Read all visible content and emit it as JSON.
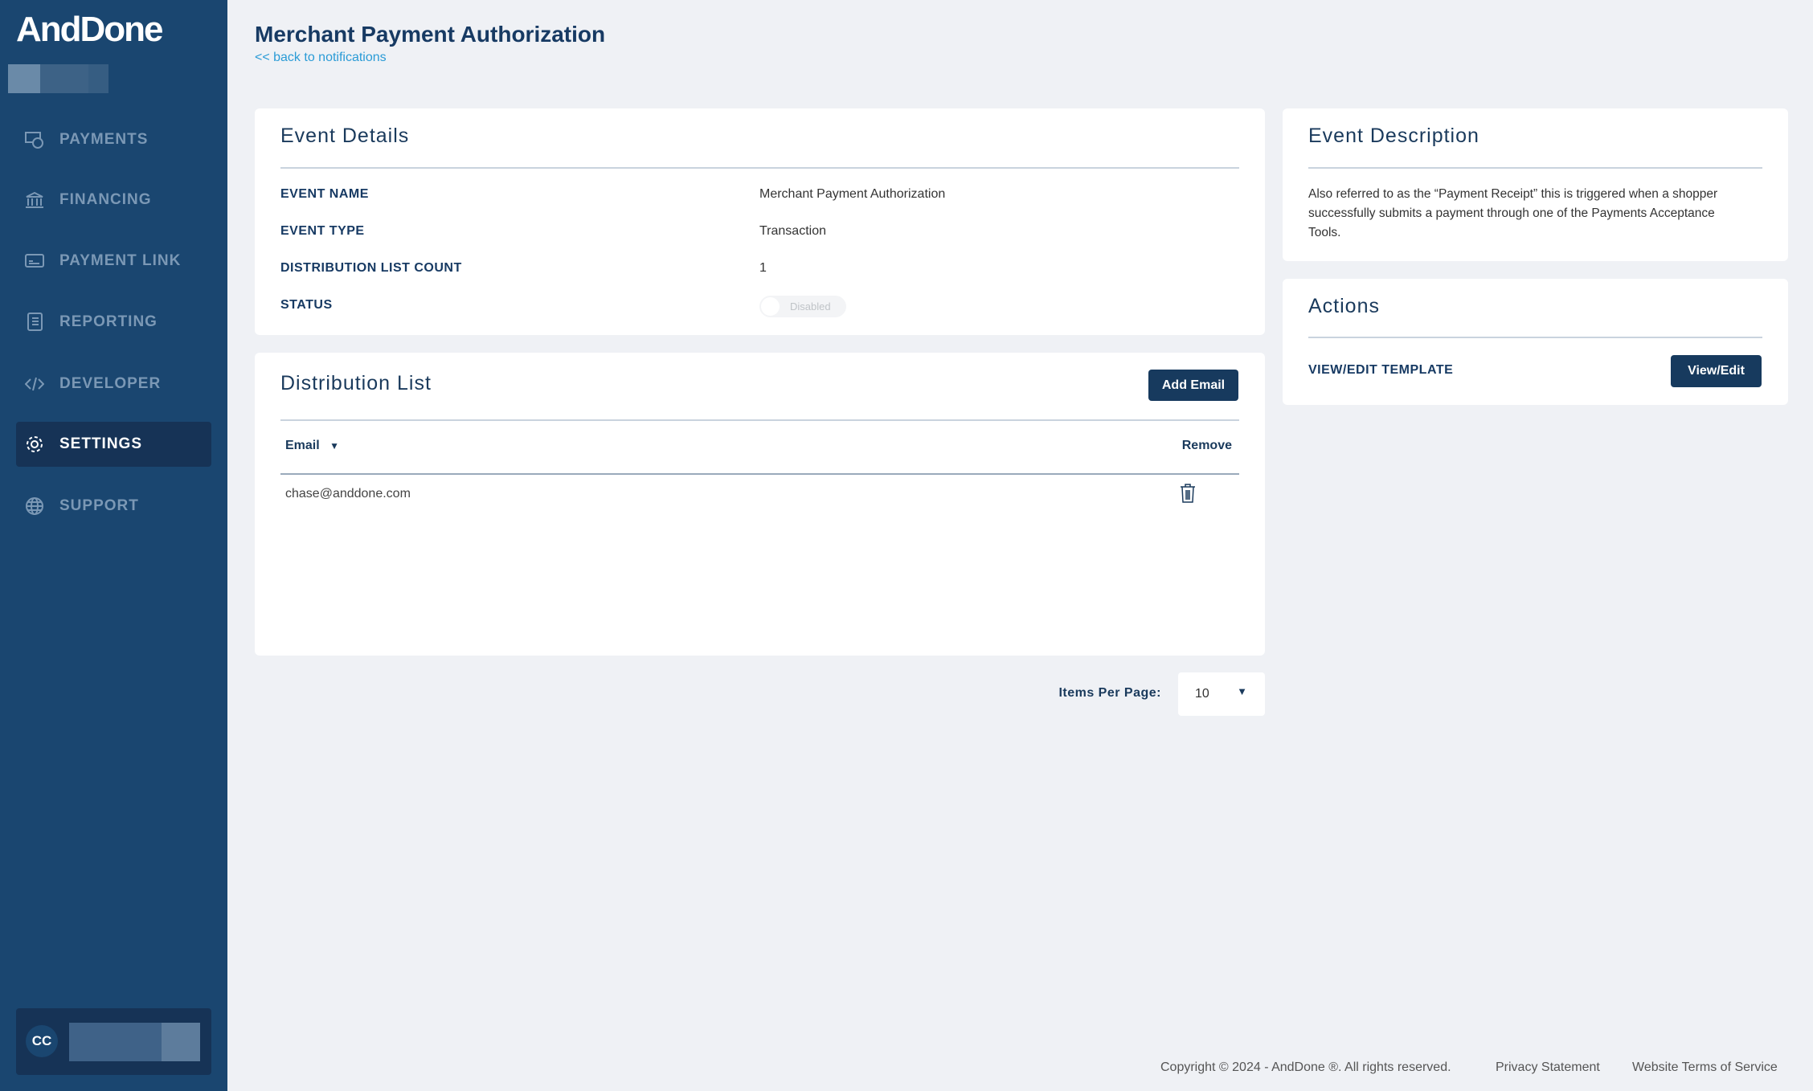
{
  "brand": "AndDone",
  "sidebar": {
    "items": [
      {
        "label": "PAYMENTS",
        "icon": "payments-icon"
      },
      {
        "label": "FINANCING",
        "icon": "bank-icon"
      },
      {
        "label": "PAYMENT LINK",
        "icon": "card-icon"
      },
      {
        "label": "REPORTING",
        "icon": "report-icon"
      },
      {
        "label": "DEVELOPER",
        "icon": "code-icon"
      },
      {
        "label": "SETTINGS",
        "icon": "gear-icon",
        "active": true
      },
      {
        "label": "SUPPORT",
        "icon": "globe-icon"
      }
    ],
    "user_initials": "CC"
  },
  "header": {
    "title": "Merchant Payment Authorization",
    "back_link": "<< back to notifications"
  },
  "event_details": {
    "title": "Event Details",
    "rows": [
      {
        "label": "EVENT NAME",
        "value": "Merchant Payment Authorization"
      },
      {
        "label": "EVENT TYPE",
        "value": "Transaction"
      },
      {
        "label": "DISTRIBUTION LIST COUNT",
        "value": "1"
      },
      {
        "label": "STATUS",
        "value": "Disabled"
      }
    ]
  },
  "distribution": {
    "title": "Distribution List",
    "add_label": "Add Email",
    "col_email": "Email",
    "col_remove": "Remove",
    "rows": [
      {
        "email": "chase@anddone.com"
      }
    ]
  },
  "pagination": {
    "label": "Items Per Page:",
    "value": "10"
  },
  "event_description": {
    "title": "Event Description",
    "text": "Also referred to as the “Payment Receipt” this is triggered when a shopper successfully submits a payment through one of the Payments Acceptance Tools."
  },
  "actions": {
    "title": "Actions",
    "label": "VIEW/EDIT TEMPLATE",
    "button": "View/Edit"
  },
  "footer": {
    "copyright": "Copyright © 2024 - AndDone ®. All rights reserved.",
    "privacy": "Privacy Statement",
    "terms": "Website Terms of Service"
  }
}
